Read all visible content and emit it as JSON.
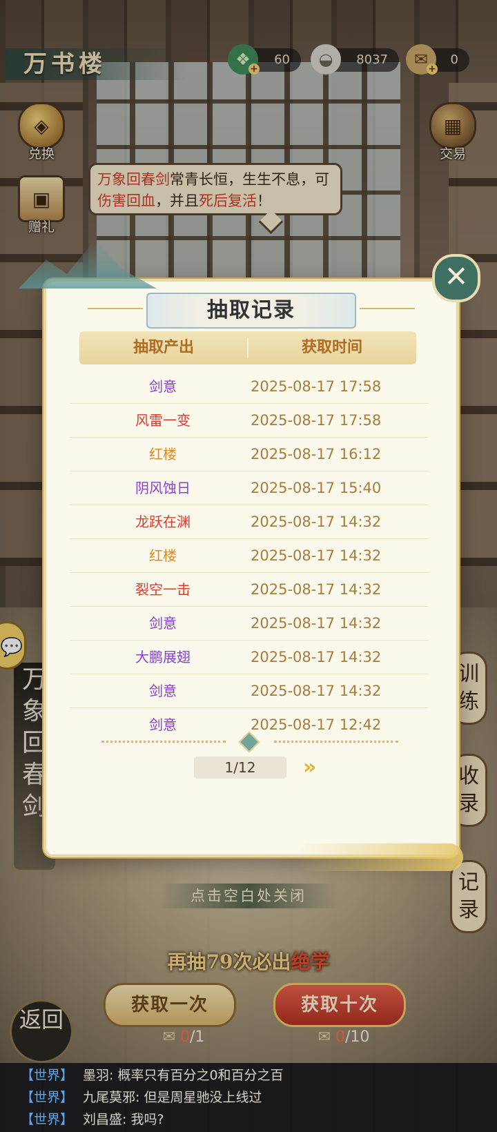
{
  "location": {
    "title": "万书楼"
  },
  "resources": [
    {
      "icon": "jade-dragon-icon",
      "value": "60"
    },
    {
      "icon": "silver-ingot-icon",
      "value": "8037"
    },
    {
      "icon": "scroll-ticket-icon",
      "value": "0"
    }
  ],
  "side_buttons": {
    "exchange": "兑换",
    "gift": "赠礼",
    "trade": "交易"
  },
  "bubble": {
    "part1": "万象回春剑",
    "part2": "常青长恒，生生不息，可",
    "part3": "伤害回血",
    "part4": "，并且",
    "part5": "死后复活",
    "part6": "！"
  },
  "right_tabs": {
    "train": "训练",
    "collect": "收录",
    "record": "记录"
  },
  "big_title": "万象回春剑",
  "modal": {
    "title": "抽取记录",
    "col_item": "抽取产出",
    "col_time": "获取时间",
    "rows": [
      {
        "item": "剑意",
        "time": "2025-08-17   17:58"
      },
      {
        "item": "风雷一变",
        "time": "2025-08-17   17:58"
      },
      {
        "item": "红楼",
        "time": "2025-08-17   16:12"
      },
      {
        "item": "阴风蚀日",
        "time": "2025-08-17   15:40"
      },
      {
        "item": "龙跃在渊",
        "time": "2025-08-17   14:32"
      },
      {
        "item": "红楼",
        "time": "2025-08-17   14:32"
      },
      {
        "item": "裂空一击",
        "time": "2025-08-17   14:32"
      },
      {
        "item": "剑意",
        "time": "2025-08-17   14:32"
      },
      {
        "item": "大鹏展翅",
        "time": "2025-08-17   14:32"
      },
      {
        "item": "剑意",
        "time": "2025-08-17   14:32"
      },
      {
        "item": "剑意",
        "time": "2025-08-17   12:42"
      }
    ],
    "page": "1/12",
    "next": "»"
  },
  "rarity_colors": {
    "purple": "#8a3fd0",
    "red": "#e03a2e",
    "orange": "#e08a18"
  },
  "close_hint": "点击空白处关闭",
  "guarantee": {
    "pre": "再抽",
    "num": "79",
    "mid": "次必出",
    "hl": "绝学"
  },
  "draw": {
    "one_label": "获取一次",
    "ten_label": "获取十次",
    "one_cost_have": "0",
    "one_cost_need": "/1",
    "ten_cost_have": "0",
    "ten_cost_need": "/10"
  },
  "return_label": "返回",
  "chat": [
    {
      "channel": "【世界】",
      "message": "墨羽: 概率只有百分之0和百分之百"
    },
    {
      "channel": "【世界】",
      "message": "九尾莫邪: 但是周星驰没上线过"
    },
    {
      "channel": "【世界】",
      "message": "刘昌盛: 我吗?"
    }
  ]
}
